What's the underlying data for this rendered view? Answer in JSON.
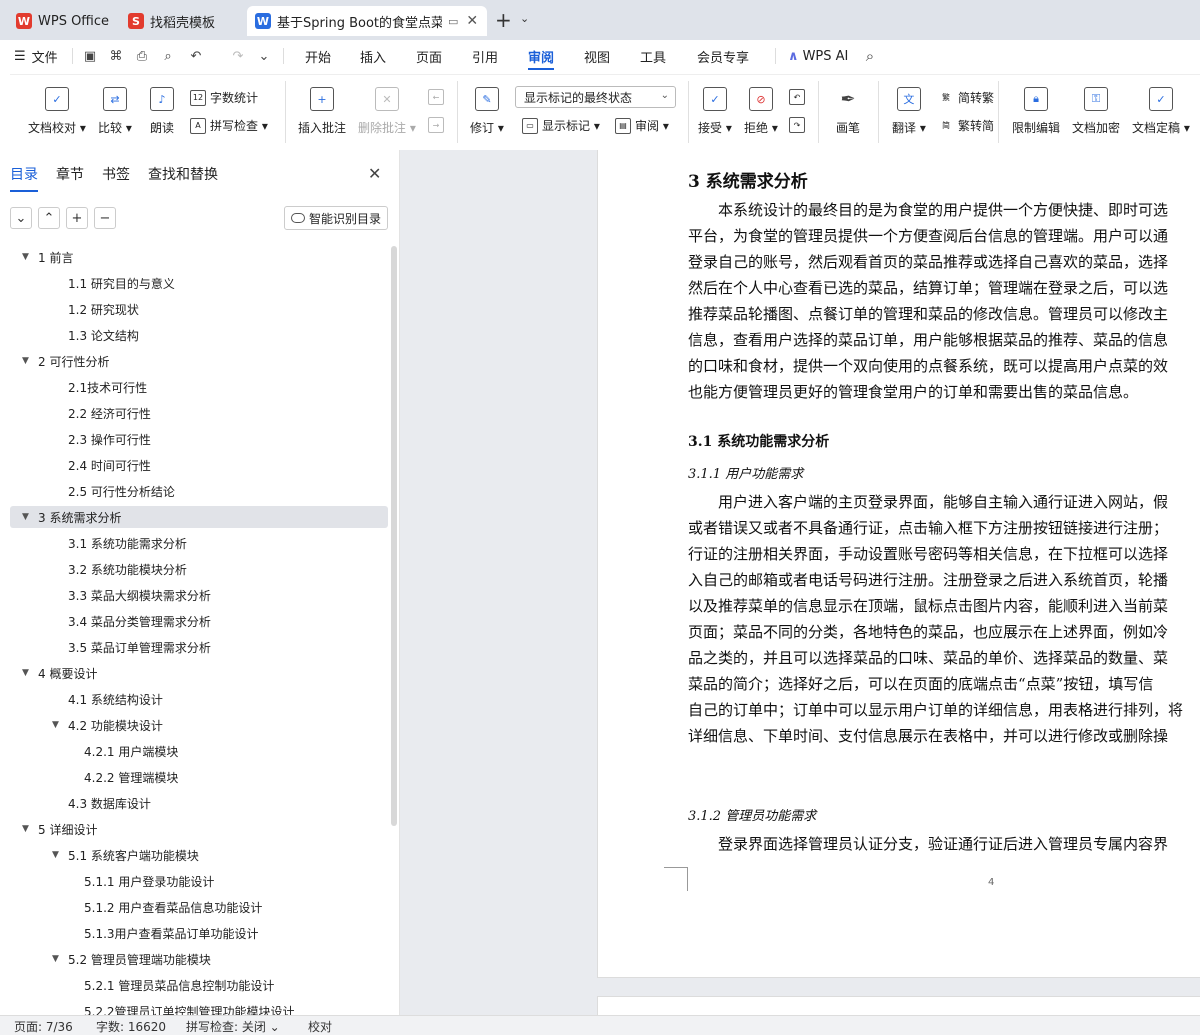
{
  "tabs": [
    {
      "label": "WPS Office",
      "icon": "wps-icon",
      "color": "#e23b2e"
    },
    {
      "label": "找稻壳模板",
      "icon": "docer-icon",
      "color": "#e23b2e"
    },
    {
      "label": "基于Spring Boot的食堂点菜管",
      "icon": "writer-icon",
      "color": "#2a6de0"
    }
  ],
  "menu": {
    "file": "文件",
    "items": [
      "开始",
      "插入",
      "页面",
      "引用",
      "审阅",
      "视图",
      "工具",
      "会员专享"
    ],
    "active": "审阅",
    "ai": "WPS AI"
  },
  "ribbon": {
    "doc_check": "文档校对",
    "compare": "比较",
    "read_aloud": "朗读",
    "word_count": "字数统计",
    "spell_check": "拼写检查",
    "insert_comment": "插入批注",
    "delete_comment": "删除批注",
    "revise": "修订",
    "markup_state": "显示标记的最终状态",
    "show_markup": "显示标记",
    "review_pane": "审阅",
    "accept": "接受",
    "reject": "拒绝",
    "pen": "画笔",
    "translate": "翻译",
    "to_traditional": "简转繁",
    "to_simplified": "繁转简",
    "restrict_edit": "限制编辑",
    "encrypt": "文档加密",
    "finalize": "文档定稿"
  },
  "panel": {
    "tabs": [
      "目录",
      "章节",
      "书签",
      "查找和替换"
    ],
    "active_tab": "目录",
    "smart_toc": "智能识别目录",
    "toc": [
      {
        "label": "1 前言",
        "level": 0,
        "expanded": true
      },
      {
        "label": "1.1 研究目的与意义",
        "level": 1
      },
      {
        "label": "1.2 研究现状",
        "level": 1
      },
      {
        "label": "1.3 论文结构",
        "level": 1
      },
      {
        "label": "2 可行性分析",
        "level": 0,
        "expanded": true
      },
      {
        "label": "2.1技术可行性",
        "level": 1
      },
      {
        "label": "2.2 经济可行性",
        "level": 1
      },
      {
        "label": "2.3 操作可行性",
        "level": 1
      },
      {
        "label": "2.4 时间可行性",
        "level": 1
      },
      {
        "label": "2.5 可行性分析结论",
        "level": 1
      },
      {
        "label": "3 系统需求分析",
        "level": 0,
        "expanded": true,
        "selected": true
      },
      {
        "label": "3.1 系统功能需求分析",
        "level": 1
      },
      {
        "label": "3.2 系统功能模块分析",
        "level": 1
      },
      {
        "label": "3.3 菜品大纲模块需求分析",
        "level": 1
      },
      {
        "label": "3.4 菜品分类管理需求分析",
        "level": 1
      },
      {
        "label": "3.5 菜品订单管理需求分析",
        "level": 1
      },
      {
        "label": "4 概要设计",
        "level": 0,
        "expanded": true
      },
      {
        "label": "4.1 系统结构设计",
        "level": 1
      },
      {
        "label": "4.2 功能模块设计",
        "level": 1,
        "expanded": true
      },
      {
        "label": "4.2.1 用户端模块",
        "level": 2
      },
      {
        "label": "4.2.2 管理端模块",
        "level": 2
      },
      {
        "label": "4.3 数据库设计",
        "level": 1
      },
      {
        "label": "5 详细设计",
        "level": 0,
        "expanded": true
      },
      {
        "label": "5.1 系统客户端功能模块",
        "level": 1,
        "expanded": true
      },
      {
        "label": "5.1.1 用户登录功能设计",
        "level": 2
      },
      {
        "label": "5.1.2 用户查看菜品信息功能设计",
        "level": 2
      },
      {
        "label": "5.1.3用户查看菜品订单功能设计",
        "level": 2
      },
      {
        "label": "5.2 管理员管理端功能模块",
        "level": 1,
        "expanded": true
      },
      {
        "label": "5.2.1 管理员菜品信息控制功能设计",
        "level": 2
      },
      {
        "label": "5.2.2管理员订单控制管理功能模块设计",
        "level": 2
      }
    ]
  },
  "document": {
    "heading": "3 系统需求分析",
    "para1": [
      "本系统设计的最终目的是为食堂的用户提供一个方便快捷、即时可选",
      "平台，为食堂的管理员提供一个方便查阅后台信息的管理端。用户可以通",
      "登录自己的账号，然后观看首页的菜品推荐或选择自己喜欢的菜品，选择",
      "然后在个人中心查看已选的菜品，结算订单；管理端在登录之后，可以选",
      "推荐菜品轮播图、点餐订单的管理和菜品的修改信息。管理员可以修改主",
      "信息，查看用户选择的菜品订单，用户能够根据菜品的推荐、菜品的信息",
      "的口味和食材，提供一个双向使用的点餐系统，既可以提高用户点菜的效",
      "也能方便管理员更好的管理食堂用户的订单和需要出售的菜品信息。"
    ],
    "h31": "3.1 系统功能需求分析",
    "h311": "3.1.1 用户功能需求",
    "para2": [
      "用户进入客户端的主页登录界面，能够自主输入通行证进入网站，假",
      "或者错误又或者不具备通行证，点击输入框下方注册按钮链接进行注册；",
      "行证的注册相关界面，手动设置账号密码等相关信息，在下拉框可以选择",
      "入自己的邮箱或者电话号码进行注册。注册登录之后进入系统首页，轮播",
      "以及推荐菜单的信息显示在顶端，鼠标点击图片内容，能顺利进入当前菜",
      "页面；菜品不同的分类，各地特色的菜品，也应展示在上述界面，例如冷",
      "品之类的，并且可以选择菜品的口味、菜品的单价、选择菜品的数量、菜",
      "菜品的简介；选择好之后，可以在页面的底端点击“点菜”按钮，填写信",
      "自己的订单中；订单中可以显示用户订单的详细信息，用表格进行排列，将",
      "详细信息、下单时间、支付信息展示在表格中，并可以进行修改或删除操"
    ],
    "h312": "3.1.2 管理员功能需求",
    "para3": [
      "登录界面选择管理员认证分支，验证通行证后进入管理员专属内容界"
    ],
    "page_number": "4"
  },
  "status": {
    "page": "页面: 7/36",
    "words": "字数: 16620",
    "spell": "拼写检查: 关闭",
    "proof": "校对"
  }
}
